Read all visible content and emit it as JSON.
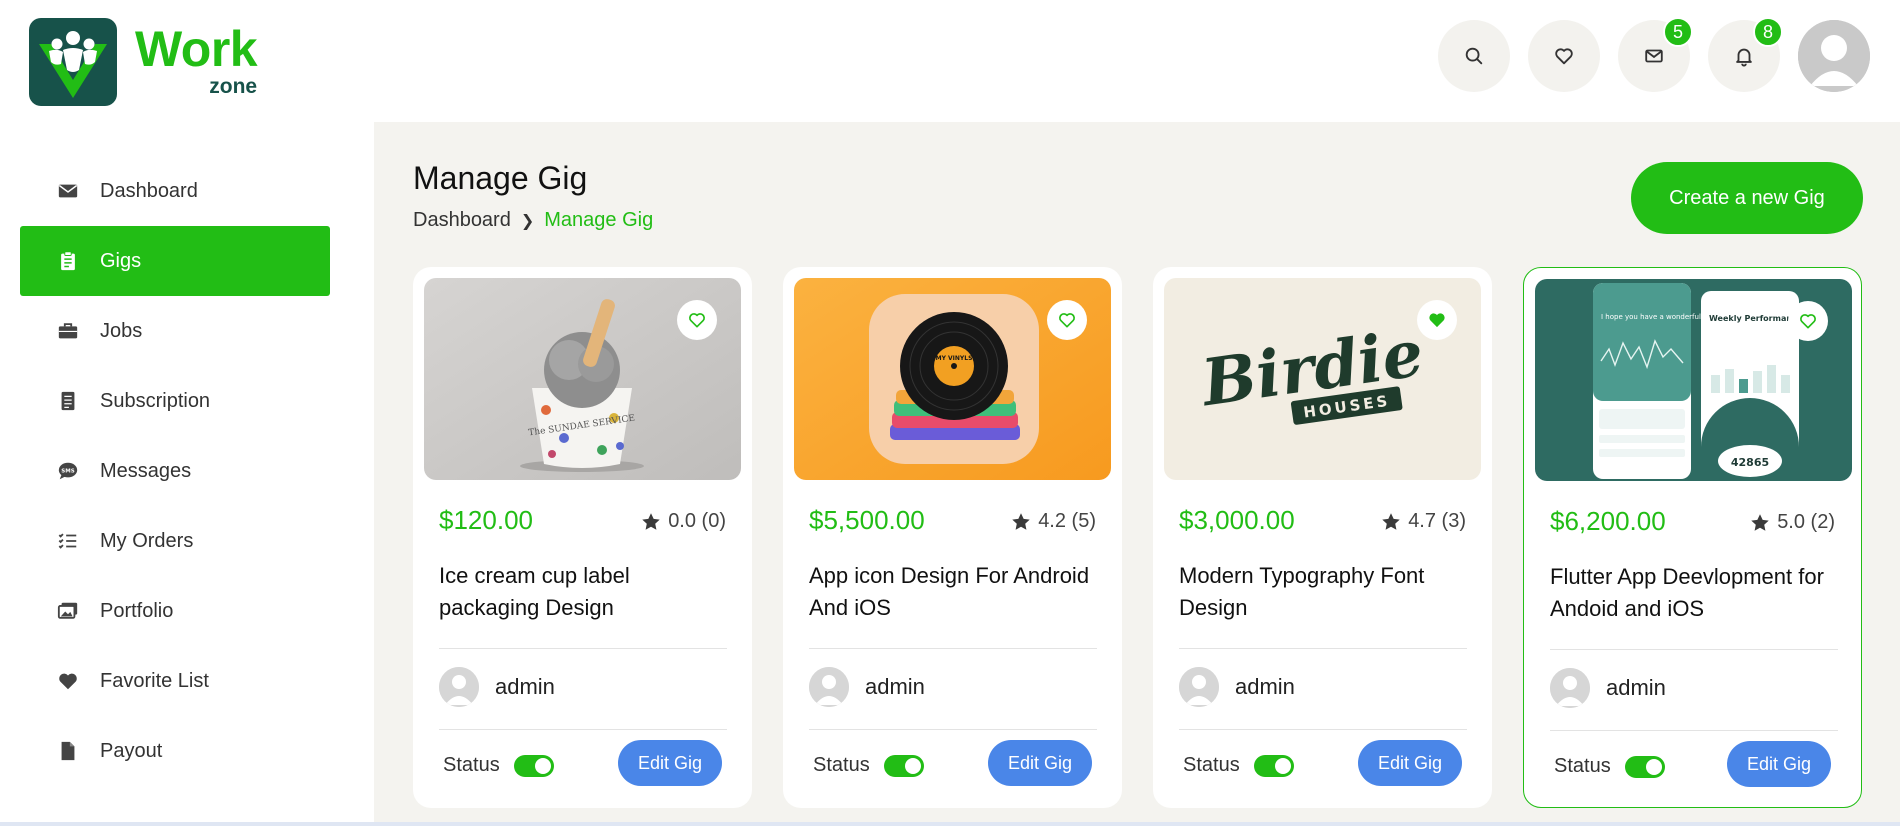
{
  "brand": {
    "name_main": "Work",
    "name_sub": "zone"
  },
  "header": {
    "messages_count": "5",
    "notifications_count": "8"
  },
  "sidebar": {
    "items": [
      {
        "label": "Dashboard",
        "icon": "envelope-icon"
      },
      {
        "label": "Gigs",
        "icon": "clipboard-icon",
        "active": true
      },
      {
        "label": "Jobs",
        "icon": "briefcase-icon"
      },
      {
        "label": "Subscription",
        "icon": "list-doc-icon"
      },
      {
        "label": "Messages",
        "icon": "sms-chat-icon"
      },
      {
        "label": "My Orders",
        "icon": "checklist-icon"
      },
      {
        "label": "Portfolio",
        "icon": "images-icon"
      },
      {
        "label": "Favorite List",
        "icon": "heart-icon"
      },
      {
        "label": "Payout",
        "icon": "file-icon"
      }
    ]
  },
  "main": {
    "title": "Manage Gig",
    "breadcrumb": {
      "root": "Dashboard",
      "current": "Manage Gig"
    },
    "create_button": "Create a new Gig",
    "gigs": [
      {
        "price": "$120.00",
        "rating": "0.0 (0)",
        "title": "Ice cream cup label packaging Design",
        "author": "admin",
        "status_label": "Status",
        "edit_label": "Edit Gig",
        "favorited": false
      },
      {
        "price": "$5,500.00",
        "rating": "4.2 (5)",
        "title": "App icon Design For Android And iOS",
        "author": "admin",
        "status_label": "Status",
        "edit_label": "Edit Gig",
        "favorited": false
      },
      {
        "price": "$3,000.00",
        "rating": "4.7 (3)",
        "title": "Modern Typography Font Design",
        "author": "admin",
        "status_label": "Status",
        "edit_label": "Edit Gig",
        "favorited": true
      },
      {
        "price": "$6,200.00",
        "rating": "5.0 (2)",
        "title": "Flutter App Deevlopment for Andoid and iOS",
        "author": "admin",
        "status_label": "Status",
        "edit_label": "Edit Gig",
        "favorited": false
      }
    ],
    "image_texts": {
      "birdie_word": "Birdie",
      "birdie_sub": "HOUSES",
      "cup_text": "The SUNDAE SERVICE",
      "vinyl_text": "MY VINYLS",
      "app_greeting": "I hope you have a wonderful day!",
      "app_weekly": "Weekly Performance",
      "app_steps": "42865"
    }
  },
  "colors": {
    "accent": "#22bd15",
    "brand_dark": "#17524a",
    "edit_button": "#4a86e8",
    "main_bg": "#f4f3ef"
  }
}
